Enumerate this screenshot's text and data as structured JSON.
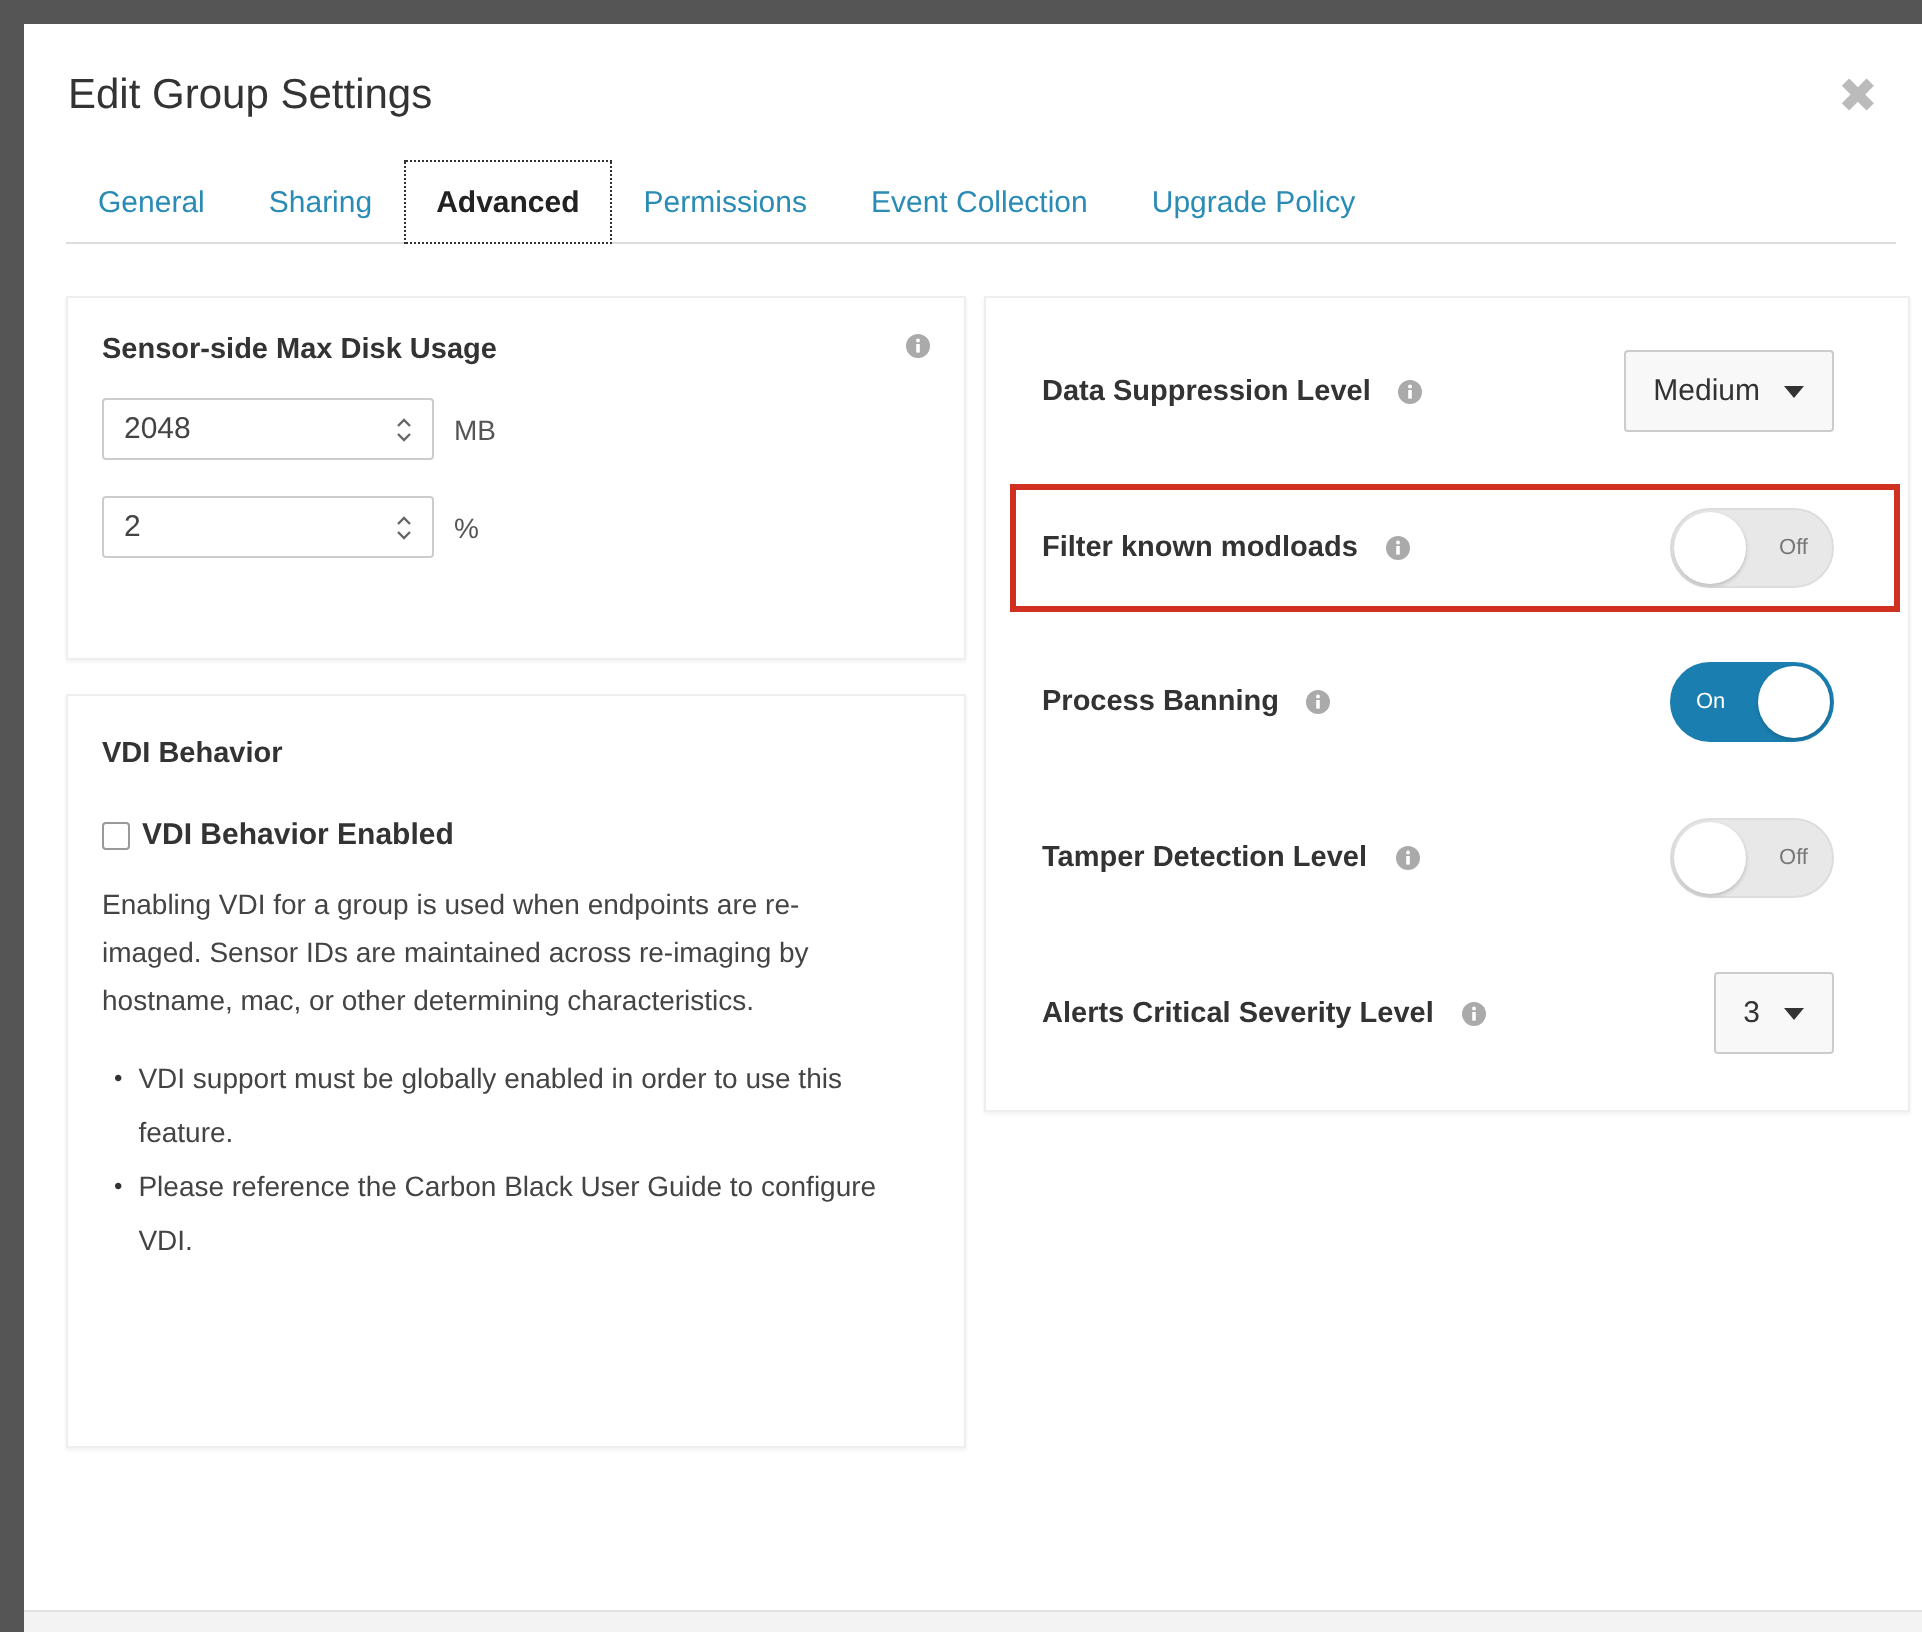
{
  "dialog": {
    "title": "Edit Group Settings",
    "close": "✖"
  },
  "tabs": [
    {
      "label": "General",
      "selected": false
    },
    {
      "label": "Sharing",
      "selected": false
    },
    {
      "label": "Advanced",
      "selected": true
    },
    {
      "label": "Permissions",
      "selected": false
    },
    {
      "label": "Event Collection",
      "selected": false
    },
    {
      "label": "Upgrade Policy",
      "selected": false
    }
  ],
  "disk_usage": {
    "title": "Sensor-side Max Disk Usage",
    "fields": [
      {
        "value": "2048",
        "unit": "MB"
      },
      {
        "value": "2",
        "unit": "%"
      }
    ]
  },
  "vdi": {
    "title": "VDI Behavior",
    "checkbox": {
      "label": "VDI Behavior Enabled",
      "checked": false
    },
    "description": "Enabling VDI for a group is used when endpoints are re-imaged. Sensor IDs are maintained across re-imaging by hostname, mac, or other determining characteristics.",
    "notes": [
      {
        "bullet": "•",
        "text": "VDI support must be globally enabled in order to use this feature."
      },
      {
        "bullet": "•",
        "text": "Please reference the Carbon Black User Guide to configure VDI."
      }
    ]
  },
  "settings": [
    {
      "kind": "dropdown",
      "label": "Data Suppression Level",
      "value": "Medium",
      "highlighted": false
    },
    {
      "kind": "toggle",
      "label": "Filter known modloads",
      "on": false,
      "state_text": "Off",
      "highlighted": true
    },
    {
      "kind": "toggle",
      "label": "Process Banning",
      "on": true,
      "state_text": "On",
      "highlighted": false
    },
    {
      "kind": "toggle",
      "label": "Tamper Detection Level",
      "on": false,
      "state_text": "Off",
      "highlighted": false
    },
    {
      "kind": "dropdown",
      "label": "Alerts Critical Severity Level",
      "value": "3",
      "highlighted": false
    }
  ]
}
